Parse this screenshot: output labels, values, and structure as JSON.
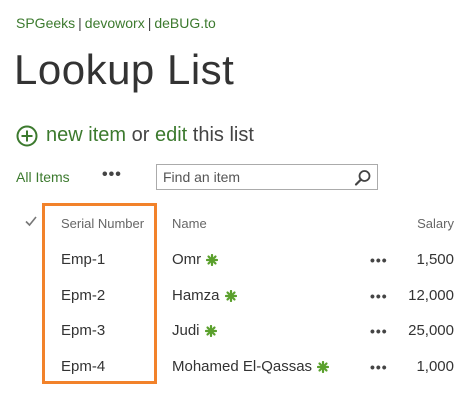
{
  "breadcrumb": {
    "items": [
      "SPGeeks",
      "devoworx",
      "deBUG.to"
    ],
    "separator": "|"
  },
  "page": {
    "title": "Lookup List"
  },
  "actions": {
    "new_item_label": "new item",
    "or_label": "or",
    "edit_label": "edit",
    "this_list_label": "this list"
  },
  "toolbar": {
    "view_label": "All Items",
    "more_label": "•••",
    "search_placeholder": "Find an item"
  },
  "table": {
    "columns": {
      "serial": "Serial Number",
      "name": "Name",
      "salary": "Salary"
    },
    "rows": [
      {
        "serial": "Emp-1",
        "name": "Omr",
        "more": "•••",
        "salary": "1,500"
      },
      {
        "serial": "Epm-2",
        "name": "Hamza",
        "more": "•••",
        "salary": "12,000"
      },
      {
        "serial": "Epm-3",
        "name": "Judi",
        "more": "•••",
        "salary": "25,000"
      },
      {
        "serial": "Epm-4",
        "name": "Mohamed El-Qassas",
        "more": "•••",
        "salary": "1,000"
      }
    ]
  },
  "icons": {
    "plus": "plus-circle-icon",
    "search": "search-icon",
    "check": "checkmark-icon",
    "new": "new-item-icon"
  },
  "colors": {
    "accent_green": "#3c7a2e",
    "new_badge_green": "#5aa02c",
    "highlight_orange": "#f2822a",
    "text_dark": "#333333"
  }
}
